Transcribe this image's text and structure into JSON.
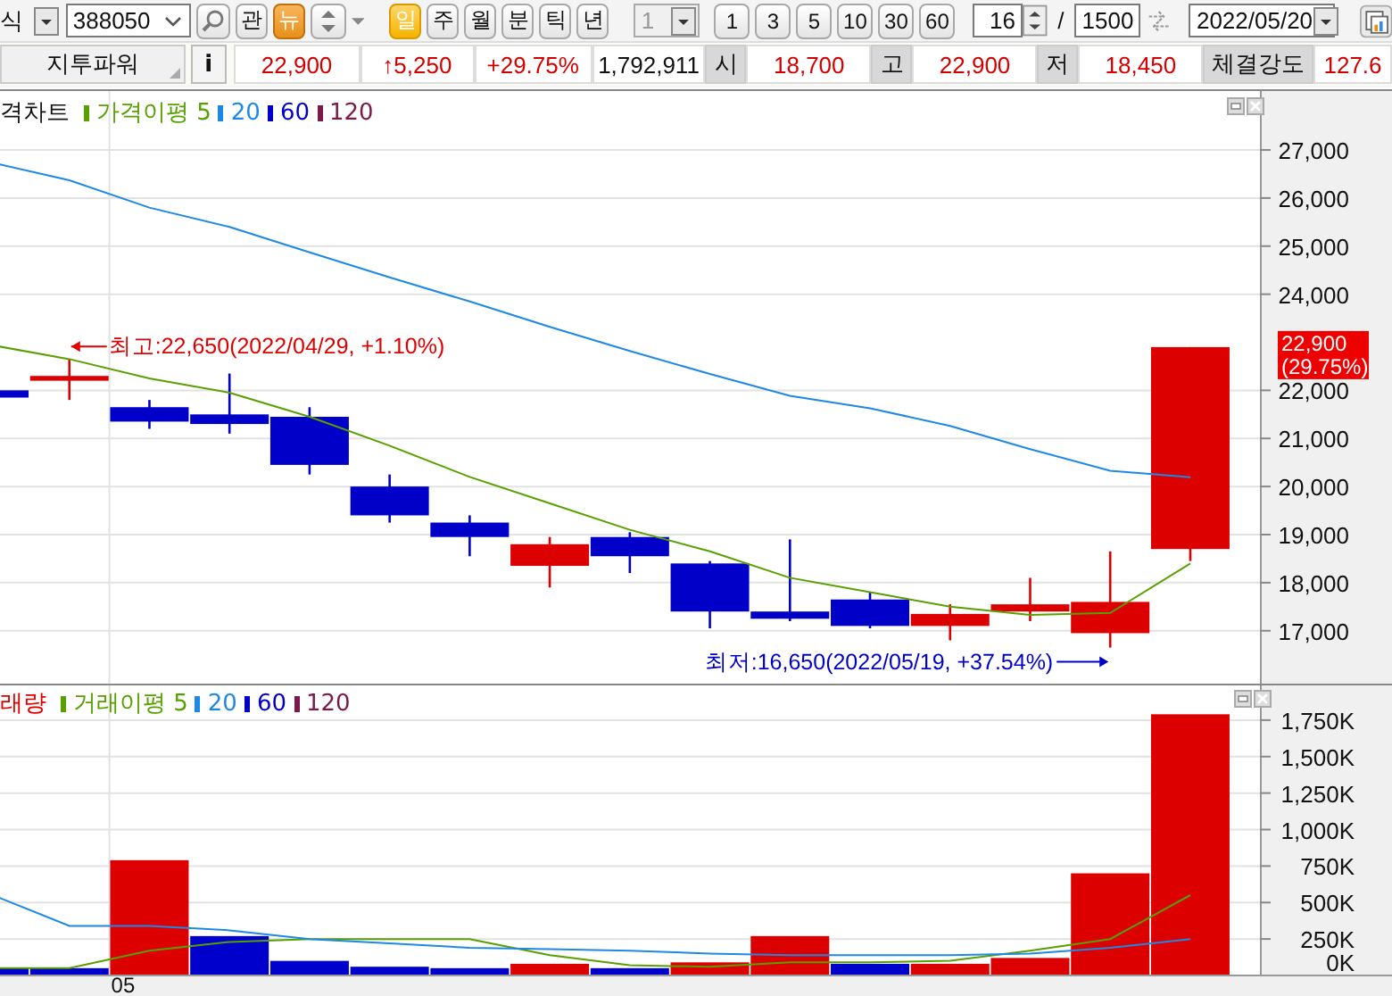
{
  "toolbar": {
    "market_dropdown": {
      "value": "식"
    },
    "code_field": {
      "value": "388050"
    },
    "news_buttons": [
      {
        "label": "관",
        "active": false
      },
      {
        "label": "뉴",
        "active": true
      }
    ],
    "period_tabs": [
      {
        "label": "일",
        "selected": true
      },
      {
        "label": "주",
        "selected": false
      },
      {
        "label": "월",
        "selected": false
      },
      {
        "label": "분",
        "selected": false
      },
      {
        "label": "틱",
        "selected": false
      },
      {
        "label": "년",
        "selected": false
      }
    ],
    "unit_dropdown": {
      "value": "1",
      "disabled": true
    },
    "interval_buttons": [
      "1",
      "3",
      "5",
      "10",
      "30",
      "60"
    ],
    "count_field": {
      "value": "16"
    },
    "separator": "/",
    "total_field": {
      "value": "1500"
    },
    "date_dropdown": {
      "value": "2022/05/20"
    }
  },
  "quote_bar": {
    "name": "지투파워",
    "info_button": "i",
    "rising": true,
    "price": "22,900",
    "change": "↑5,250",
    "change_rate": "+29.75%",
    "volume": "1,792,911",
    "stats": [
      {
        "label": "시",
        "value": "18,700",
        "rising": true
      },
      {
        "label": "고",
        "value": "22,900",
        "rising": true
      },
      {
        "label": "저",
        "value": "18,450",
        "rising": true
      },
      {
        "label": "체결강도",
        "value": "127.6",
        "rising": true
      }
    ]
  },
  "price_panel": {
    "title": "격차트",
    "last_tag": [
      "22,900",
      "(29.75%)"
    ],
    "chart_data": {
      "type": "candlestick",
      "grid": true,
      "categories": [
        null,
        null,
        null,
        null,
        null,
        null,
        null,
        null,
        null,
        null,
        null,
        null,
        null,
        null,
        null,
        null
      ],
      "ylim": [
        15900,
        28300
      ],
      "yticks": [
        {
          "value": 17000,
          "label": "17,000"
        },
        {
          "value": 18000,
          "label": "18,000"
        },
        {
          "value": 19000,
          "label": "19,000"
        },
        {
          "value": 20000,
          "label": "20,000"
        },
        {
          "value": 21000,
          "label": "21,000"
        },
        {
          "value": 22000,
          "label": "22,000"
        },
        {
          "value": 24000,
          "label": "24,000"
        },
        {
          "value": 25000,
          "label": "25,000"
        },
        {
          "value": 26000,
          "label": "26,000"
        },
        {
          "value": 27000,
          "label": "27,000"
        }
      ],
      "series": [
        {
          "ohlc": [
            [
              22000,
              22000,
              21850,
              21850
            ],
            [
              22200,
              22650,
              21800,
              22300
            ],
            [
              21650,
              21800,
              21200,
              21350
            ],
            [
              21500,
              22350,
              21100,
              21300
            ],
            [
              21450,
              21650,
              20250,
              20450
            ],
            [
              20000,
              20250,
              19250,
              19400
            ],
            [
              19250,
              19400,
              18550,
              18950
            ],
            [
              18350,
              18950,
              17900,
              18800
            ],
            [
              18950,
              19050,
              18200,
              18550
            ],
            [
              18400,
              18450,
              17050,
              17400
            ],
            [
              17400,
              18900,
              17200,
              17250
            ],
            [
              17650,
              17800,
              17050,
              17100
            ],
            [
              17100,
              17550,
              16800,
              17350
            ],
            [
              17400,
              18100,
              17200,
              17550
            ],
            [
              16950,
              18650,
              16650,
              17600
            ],
            [
              18700,
              22900,
              18450,
              22900
            ]
          ]
        },
        {
          "name": "가격이평 5",
          "type": "line",
          "color": "#58a000",
          "values": [
            22950,
            22650,
            22250,
            21950,
            21450,
            20850,
            20200,
            19650,
            19100,
            18650,
            18100,
            17800,
            17500,
            17330,
            17370,
            18400
          ]
        },
        {
          "name": "20",
          "type": "line",
          "color": "#1e88e5",
          "values": [
            26750,
            26370,
            25800,
            25400,
            24870,
            24350,
            23850,
            23320,
            22820,
            22340,
            21890,
            21630,
            21260,
            20780,
            20330,
            20190
          ]
        },
        {
          "name": "60",
          "type": "line",
          "color": "#0000c8",
          "values": [
            null,
            null,
            null,
            null,
            null,
            null,
            null,
            null,
            null,
            null,
            null,
            null,
            null,
            null,
            null,
            null
          ]
        },
        {
          "name": "120",
          "type": "line",
          "color": "#7a1a4a",
          "values": [
            null,
            null,
            null,
            null,
            null,
            null,
            null,
            null,
            null,
            null,
            null,
            null,
            null,
            null,
            null,
            null
          ]
        }
      ],
      "annotations": [
        "최고:22,650(2022/04/29, +1.10%)",
        "최저:16,650(2022/05/19, +37.54%)"
      ]
    }
  },
  "volume_panel": {
    "title": "래량",
    "date_labels": [
      "05"
    ],
    "chart_data": {
      "type": "bar",
      "stacked": true,
      "grid": true,
      "categories": [
        null,
        null,
        null,
        null,
        null,
        null,
        null,
        null,
        null,
        null,
        null,
        null,
        null,
        null,
        null,
        null
      ],
      "ylim": [
        0,
        2000000
      ],
      "yticks": [
        {
          "value": 0,
          "label": "0K"
        },
        {
          "value": 250000,
          "label": "250K"
        },
        {
          "value": 500000,
          "label": "500K"
        },
        {
          "value": 750000,
          "label": "750K"
        },
        {
          "value": 1000000,
          "label": "1,000K"
        },
        {
          "value": 1250000,
          "label": "1,250K"
        },
        {
          "value": 1500000,
          "label": "1,500K"
        },
        {
          "value": 1750000,
          "label": "1,750K"
        }
      ],
      "series": [
        {
          "color": "#dd0000",
          "values": [
            null,
            null,
            790000,
            null,
            null,
            null,
            null,
            80000,
            null,
            90000,
            270000,
            null,
            80000,
            120000,
            700000,
            1790000
          ]
        },
        {
          "color": "#0000cc",
          "values": [
            50000,
            50000,
            null,
            270000,
            100000,
            60000,
            50000,
            null,
            50000,
            null,
            null,
            80000,
            null,
            null,
            null,
            null
          ]
        },
        {
          "name": "거래이평 5",
          "type": "line",
          "color": "#58a000",
          "values": [
            50000,
            50000,
            170000,
            230000,
            250000,
            250000,
            250000,
            140000,
            70000,
            60000,
            90000,
            90000,
            100000,
            170000,
            250000,
            550000
          ]
        },
        {
          "name": "20",
          "type": "line",
          "color": "#1e88e5",
          "values": [
            560000,
            340000,
            340000,
            310000,
            250000,
            220000,
            190000,
            180000,
            170000,
            150000,
            140000,
            140000,
            140000,
            150000,
            190000,
            250000
          ]
        },
        {
          "name": "60",
          "type": "line",
          "color": "#0000c8",
          "values": [
            null,
            null,
            null,
            null,
            null,
            null,
            null,
            null,
            null,
            null,
            null,
            null,
            null,
            null,
            null,
            null
          ]
        },
        {
          "name": "120",
          "type": "line",
          "color": "#7a1a4a",
          "values": [
            null,
            null,
            null,
            null,
            null,
            null,
            null,
            null,
            null,
            null,
            null,
            null,
            null,
            null,
            null,
            null
          ]
        }
      ]
    }
  }
}
